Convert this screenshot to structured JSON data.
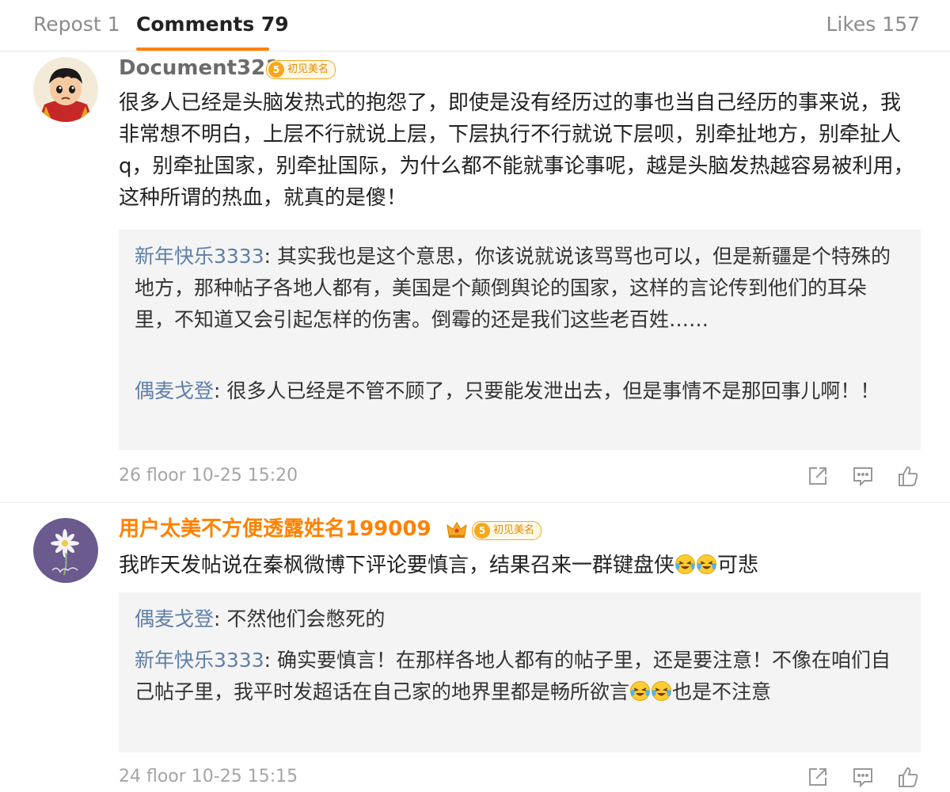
{
  "tabs": {
    "repost": "Repost 1",
    "comments": "Comments 79",
    "likes": "Likes 157"
  },
  "comments": [
    {
      "username": "Document321",
      "level": "5",
      "badge": "初见美名",
      "text": "很多人已经是头脑发热式的抱怨了，即使是没有经历过的事也当自己经历的事来说，我非常想不明白，上层不行就说上层，下层执行不行就说下层呗，别牵扯地方，别牵扯人q，别牵扯国家，别牵扯国际，为什么都不能就事论事呢，越是头脑发热越容易被利用，这种所谓的热血，就真的是傻！",
      "replies": [
        {
          "user": "新年快乐3333",
          "text": "其实我也是这个意思，你该说就说该骂骂也可以，但是新疆是个特殊的地方，那种帖子各地人都有，美国是个颠倒舆论的国家，这样的言论传到他们的耳朵里，不知道又会引起怎样的伤害。倒霉的还是我们这些老百姓……"
        },
        {
          "user": "偶麦戈登",
          "text": "很多人已经是不管不顾了，只要能发泄出去，但是事情不是那回事儿啊！！"
        }
      ],
      "meta": "26 floor 10-25 15:20"
    },
    {
      "username": "用户太美不方便透露姓名199009",
      "level": "5",
      "badge": "初见美名",
      "text_before": "我昨天发帖说在秦枫微博下评论要慎言，结果召来一群键盘侠",
      "text_after": "可悲",
      "replies": [
        {
          "user": "偶麦戈登",
          "text": "不然他们会憋死的"
        },
        {
          "user": "新年快乐3333",
          "text_before": "确实要慎言！在那样各地人都有的帖子里，还是要注意！不像在咱们自己帖子里，我平时发超话在自己家的地界里都是畅所欲言",
          "text_after": "也是不注意"
        }
      ],
      "meta": "24 floor 10-25 15:15"
    }
  ],
  "icons": {
    "share": "share-icon",
    "reply": "comment-icon",
    "like": "thumbs-up-icon",
    "emoji": "laughing-crying-emoji-icon",
    "crown": "crown-icon"
  },
  "colors": {
    "accent": "#ff8200",
    "reply_name": "#5f7fa8",
    "muted": "#a5a5a5"
  }
}
